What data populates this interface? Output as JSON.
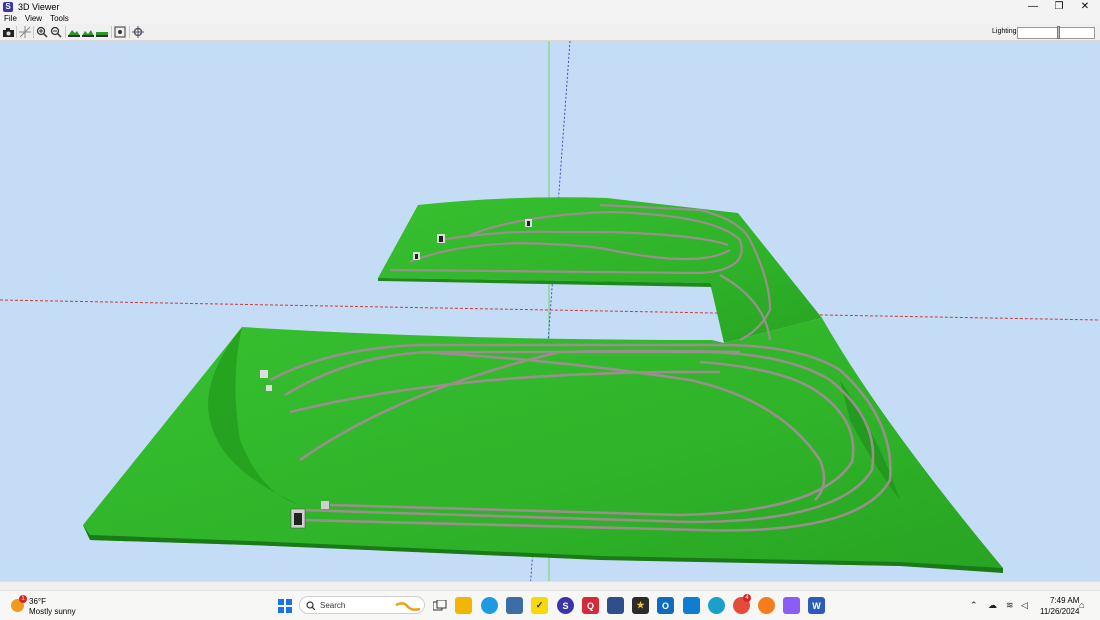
{
  "window": {
    "title": "3D Viewer",
    "app_icon_letter": "S",
    "controls": [
      "—",
      "❐",
      "✕"
    ]
  },
  "menu": {
    "items": [
      "File",
      "View",
      "Tools"
    ]
  },
  "toolbar": {
    "tools": [
      "camera-icon",
      "axes-icon",
      "zoom-in-icon",
      "zoom-out-icon",
      "terrain-1-icon",
      "terrain-2-icon",
      "terrain-3-icon",
      "fit-view-icon",
      "settings-icon"
    ],
    "lighting_label": "Lighting",
    "lighting_level": 0.53
  },
  "colors": {
    "sky": "#c5dcf6",
    "terrain": "#2fb329",
    "terrain_dark": "#1f8a1b",
    "track": "#9a8f8c",
    "axis_red": "#c83b3b",
    "axis_blue": "#3b4fc8",
    "axis_green": "#5fd45f"
  },
  "taskbar": {
    "weather": {
      "badge": "1",
      "temp": "36°F",
      "condition": "Mostly sunny"
    },
    "search_placeholder": "Search",
    "apps": [
      "windows-start-icon",
      "search-icon",
      "task-view-icon",
      "file-explorer-icon",
      "edge-dev-icon",
      "calculator-icon",
      "sticky-icon",
      "scarm-icon",
      "app-red-icon",
      "save-icon",
      "star-app-icon",
      "outlook-icon",
      "store-icon",
      "edge-icon",
      "chrome-icon",
      "app-orange-icon",
      "copilot-icon",
      "word-icon"
    ],
    "chrome_badge": "4",
    "time": "7:49 AM",
    "date": "11/26/2024"
  }
}
